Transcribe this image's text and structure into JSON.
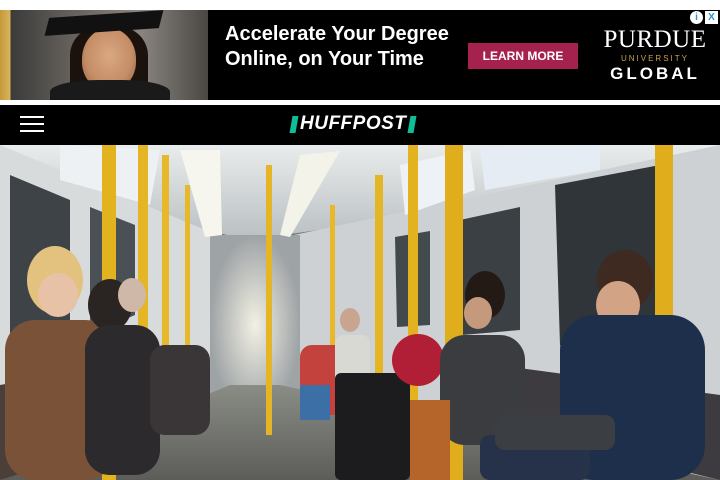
{
  "ad": {
    "headline_line1": "Accelerate Your Degree",
    "headline_line2": "Online, on Your Time",
    "cta_label": "LEARN MORE",
    "logo_line1": "PURDUE",
    "logo_line2": "UNIVERSITY",
    "logo_line3": "GLOBAL",
    "adchoices_info": "i",
    "adchoices_close": "X",
    "colors": {
      "cta": "#a6224e",
      "background": "#000000"
    }
  },
  "header": {
    "logo_text": "HUFFPOST",
    "colors": {
      "background": "#000000",
      "accent": "#0dbe98"
    }
  },
  "icons": {
    "menu": "hamburger-menu-icon",
    "ad_info": "info-icon",
    "ad_close": "close-icon"
  }
}
